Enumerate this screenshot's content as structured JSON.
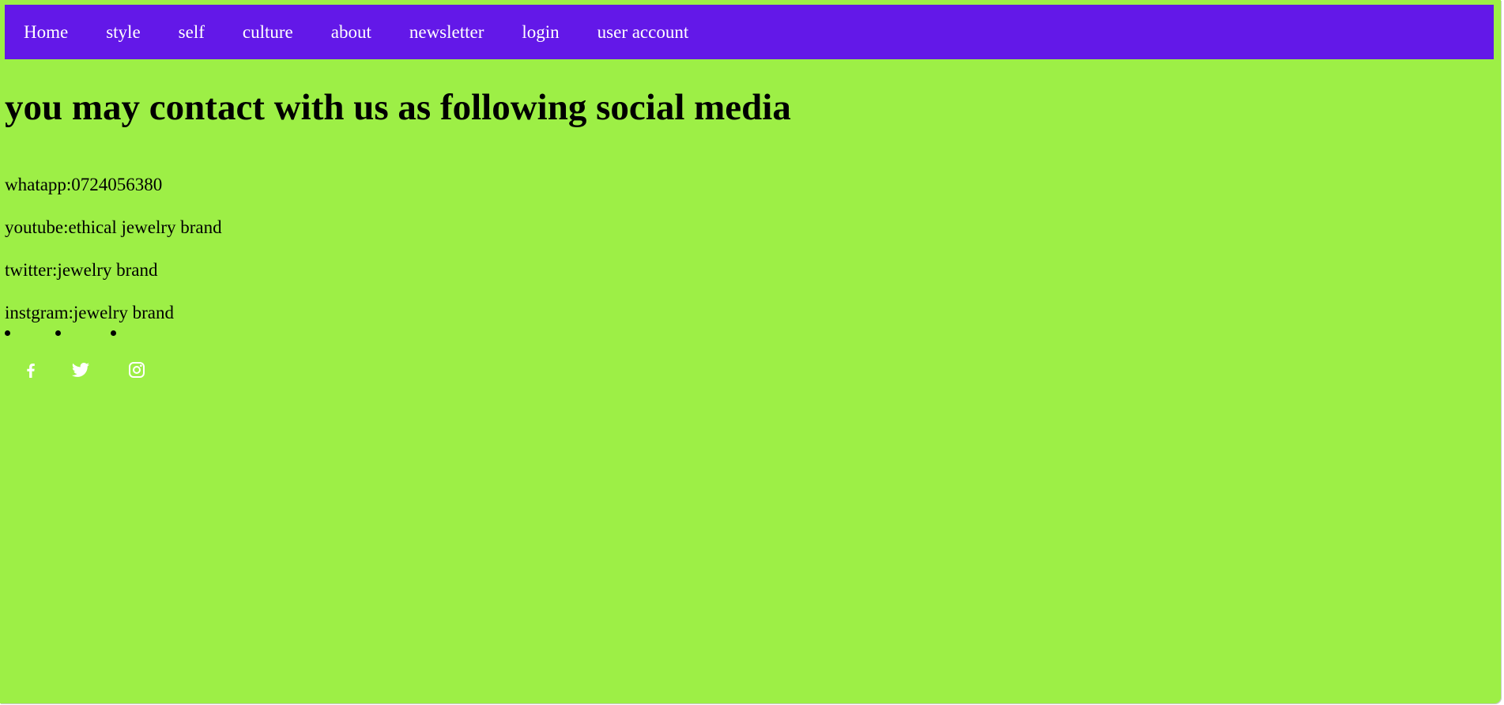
{
  "nav": {
    "items": [
      {
        "label": "Home"
      },
      {
        "label": "style"
      },
      {
        "label": "self"
      },
      {
        "label": "culture"
      },
      {
        "label": "about"
      },
      {
        "label": "newsletter"
      },
      {
        "label": "login"
      },
      {
        "label": "user account"
      }
    ]
  },
  "main": {
    "heading": "you may contact with us as following social media",
    "contacts": [
      "whatapp:0724056380",
      "youtube:ethical jewelry brand",
      "twitter:jewelry brand",
      "instgram:jewelry brand"
    ]
  },
  "social_icons": [
    {
      "icon": "facebook-icon"
    },
    {
      "icon": "twitter-icon"
    },
    {
      "icon": "instagram-icon"
    }
  ],
  "colors": {
    "page_background": "#9def46",
    "navbar_background": "#6318e8",
    "nav_text": "#ffffff",
    "body_text": "#000000",
    "icon_color": "#ffffff"
  }
}
